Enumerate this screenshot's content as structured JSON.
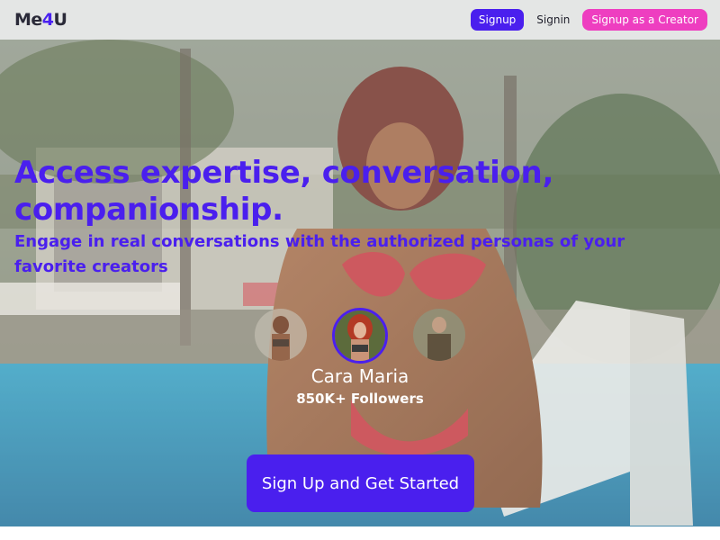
{
  "header": {
    "logo_prefix": "Me",
    "logo_accent": "4",
    "logo_suffix": "U",
    "signup_label": "Signup",
    "signin_label": "Signin",
    "creator_signup_label": "Signup as a Creator"
  },
  "hero": {
    "headline": "Access expertise, conversation, companionship.",
    "subheadline": "Engage in real conversations with the authorized personas of your favorite creators",
    "featured_creator": {
      "name": "Cara Maria",
      "followers": "850K+ Followers"
    },
    "cta_label": "Sign Up and Get Started"
  },
  "colors": {
    "brand": "#4a1fee",
    "creator_button": "#ee3ec0",
    "topbar": "#e4e6e5"
  }
}
